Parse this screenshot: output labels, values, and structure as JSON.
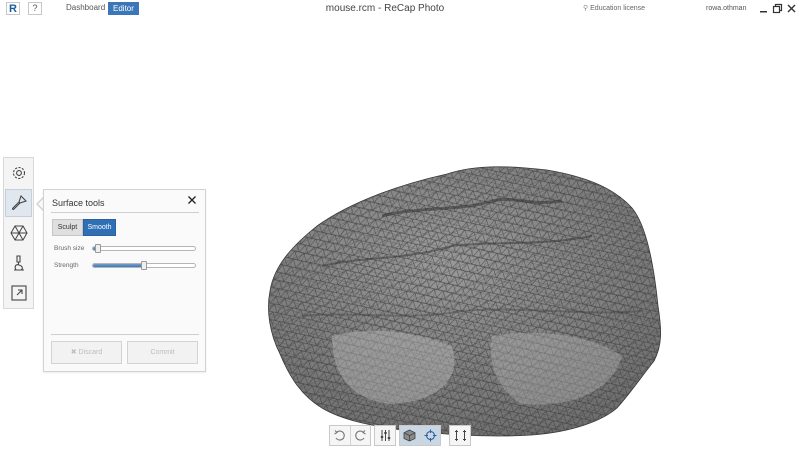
{
  "titlebar": {
    "logo": "R",
    "help": "?",
    "nav_dashboard": "Dashboard",
    "nav_editor": "Editor",
    "title": "mouse.rcm - ReCap Photo",
    "license": "Education license",
    "username": "rowa.othman",
    "min_icon": "minimize-icon",
    "max_icon": "restore-icon",
    "close_icon": "close-icon"
  },
  "tool_strip": {
    "items": [
      {
        "icon": "gear-icon",
        "active": false
      },
      {
        "icon": "brush-icon",
        "active": true
      },
      {
        "icon": "mesh-icon",
        "active": false
      },
      {
        "icon": "inspect-icon",
        "active": false
      },
      {
        "icon": "export-icon",
        "active": false
      }
    ]
  },
  "panel": {
    "title": "Surface tools",
    "close_icon": "close-icon",
    "modes": {
      "sculpt": "Sculpt",
      "smooth": "Smooth",
      "selected": "Smooth"
    },
    "brush_size": {
      "label": "Brush size",
      "value": 0.02
    },
    "strength": {
      "label": "Strength",
      "value": 0.5
    },
    "discard_label": "Discard",
    "commit_label": "Commit"
  },
  "bottom_toolbar": {
    "items": [
      {
        "icon": "undo-icon",
        "active": false
      },
      {
        "icon": "redo-icon",
        "active": false
      },
      {
        "icon": "sliders-icon",
        "active": false
      },
      {
        "icon": "cube-icon",
        "active": true
      },
      {
        "icon": "crosshair-icon",
        "active": true
      },
      {
        "icon": "bounding-box-icon",
        "active": false
      }
    ]
  },
  "colors": {
    "accent": "#2f6fb4",
    "mesh_fill": "#8c8c8c",
    "mesh_line": "#3a3a3a"
  }
}
